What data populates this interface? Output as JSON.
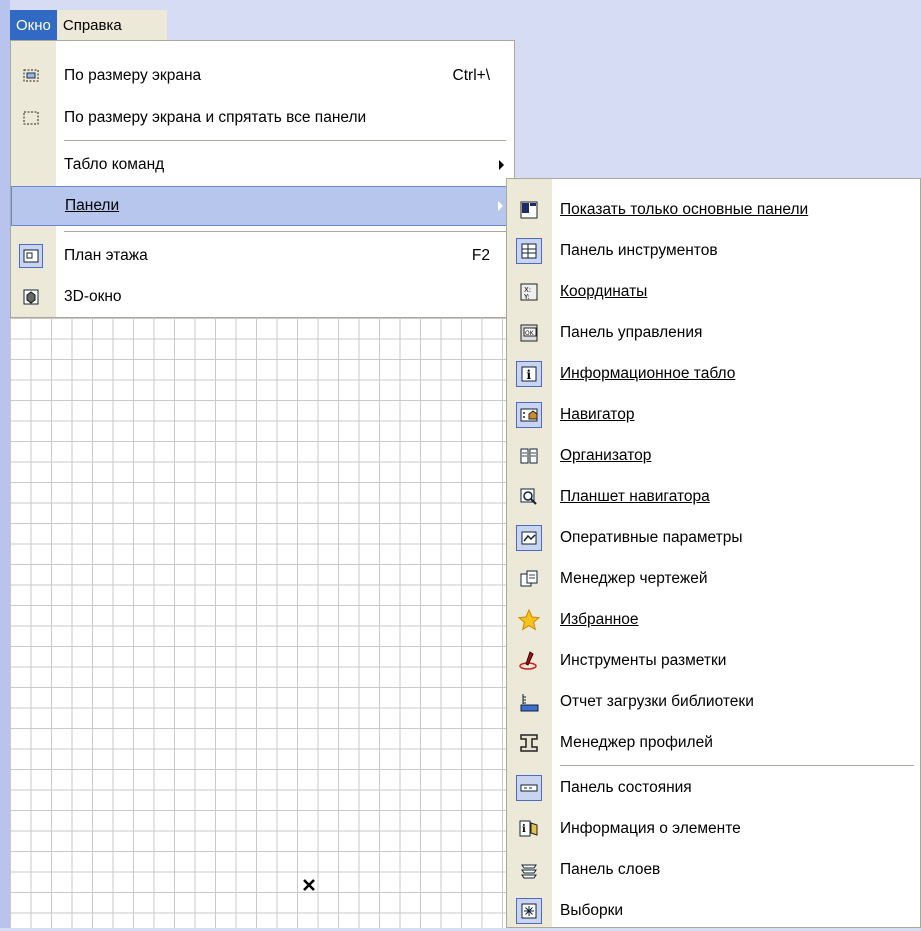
{
  "menubar": {
    "window": "Окно",
    "help": "Справка"
  },
  "window_menu": {
    "fit_screen": {
      "label": "По размеру экрана",
      "shortcut": "Ctrl+\\",
      "icon": "fit-screen-icon"
    },
    "fit_screen_hide": {
      "label": "По размеру экрана и спрятать все панели",
      "icon": "fit-screen-hide-icon"
    },
    "command_board": {
      "label": "Табло команд"
    },
    "panels": {
      "label": "Панели"
    },
    "floor_plan": {
      "label": "План этажа",
      "shortcut": "F2",
      "icon": "floor-plan-icon"
    },
    "window_3d": {
      "label": "3D-окно",
      "icon": "3d-window-icon"
    }
  },
  "panels_submenu": [
    {
      "label": "Показать только основные панели",
      "icon": "main-panels-icon"
    },
    {
      "label": "Панель инструментов",
      "icon": "toolbox-icon"
    },
    {
      "label": "Координаты",
      "icon": "coordinates-icon"
    },
    {
      "label": "Панель управления",
      "icon": "control-panel-icon"
    },
    {
      "label": "Информационное табло",
      "icon": "info-box-icon"
    },
    {
      "label": "Навигатор",
      "icon": "navigator-icon"
    },
    {
      "label": "Организатор",
      "icon": "organizer-icon"
    },
    {
      "label": "Планшет навигатора",
      "icon": "navigator-preview-icon"
    },
    {
      "label": "Оперативные параметры",
      "icon": "quick-options-icon"
    },
    {
      "label": "Менеджер чертежей",
      "icon": "drawing-manager-icon"
    },
    {
      "label": "Избранное",
      "icon": "favorites-star-icon"
    },
    {
      "label": "Инструменты разметки",
      "icon": "markup-tools-icon"
    },
    {
      "label": "Отчет загрузки библиотеки",
      "icon": "library-report-icon"
    },
    {
      "label": "Менеджер профилей",
      "icon": "profile-manager-icon"
    },
    {
      "label": "Панель состояния",
      "icon": "status-bar-icon"
    },
    {
      "label": "Информация о элементе",
      "icon": "element-info-icon"
    },
    {
      "label": "Панель слоев",
      "icon": "layers-panel-icon"
    },
    {
      "label": "Выборки",
      "icon": "selections-icon"
    }
  ]
}
